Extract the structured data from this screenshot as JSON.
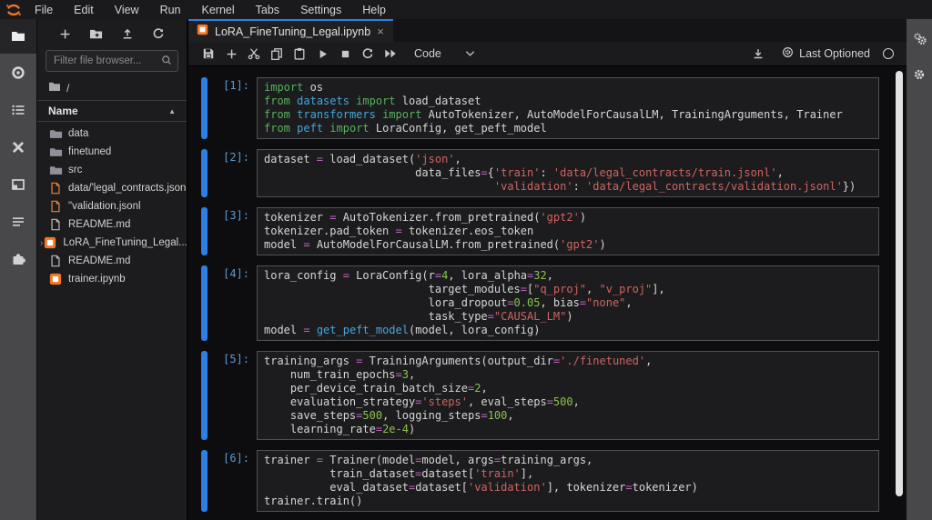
{
  "colors": {
    "accent_blue": "#2e7fe3",
    "jupyter_orange": "#f37726",
    "prompt_blue": "#5b9bd3",
    "syntax_keyword": "#55b25c",
    "syntax_module": "#46a6d9",
    "syntax_string": "#cf6460",
    "syntax_number": "#8bc34a",
    "syntax_operator": "#bd63bd",
    "syntax_default": "#d6d6d6"
  },
  "menu_bar": {
    "items": [
      "File",
      "Edit",
      "View",
      "Run",
      "Kernel",
      "Tabs",
      "Settings",
      "Help"
    ]
  },
  "activity_bar": {
    "icons": [
      "file-browser",
      "running-kernels",
      "command-palette",
      "property-inspector",
      "open-tabs",
      "table-of-contents",
      "extensions"
    ]
  },
  "right_bar": {
    "icons": [
      "notebook-tools",
      "settings-gear"
    ]
  },
  "file_browser": {
    "toolbar": [
      "new-launcher",
      "new-folder",
      "upload",
      "refresh"
    ],
    "filter_placeholder": "Filter file browser...",
    "breadcrumb": "/",
    "column_header": "Name",
    "sort_arrow": "▲",
    "files": [
      {
        "name": "data",
        "icon": "folder"
      },
      {
        "name": "finetuned",
        "icon": "folder"
      },
      {
        "name": "src",
        "icon": "folder"
      },
      {
        "name": "data/'legal_contracts.jsonl",
        "icon": "file-orange"
      },
      {
        "name": "\"validation.jsonl",
        "icon": "file-orange"
      },
      {
        "name": "README.md",
        "icon": "file"
      },
      {
        "name": "LoRA_FineTuning_Legal....",
        "icon": "notebook",
        "caret": "›"
      },
      {
        "name": "README.md",
        "icon": "file"
      },
      {
        "name": "trainer.ipynb",
        "icon": "notebook"
      }
    ]
  },
  "tab": {
    "title": "LoRA_FineTuning_Legal.ipynb",
    "close": "×"
  },
  "notebook_toolbar": {
    "buttons": [
      "save",
      "add-cell",
      "cut-cells",
      "copy-cells",
      "paste-cells",
      "run-cell",
      "stop-kernel",
      "restart-kernel",
      "run-all"
    ],
    "cell_type": "Code",
    "checkpoint_label": "Last Optioned"
  },
  "notebook": {
    "cells": [
      {
        "prompt": "[1]:",
        "source": [
          "import os",
          "from datasets import load_dataset",
          "from transformers import AutoTokenizer, AutoModelForCausalLM, TrainingArguments, Trainer",
          "from peft import LoraConfig, get_peft_model"
        ]
      },
      {
        "prompt": "[2]:",
        "source": [
          "dataset = load_dataset('json',",
          "                       data_files={'train': 'data/legal_contracts/train.jsonl',",
          "                                   'validation': 'data/legal_contracts/validation.jsonl'})"
        ]
      },
      {
        "prompt": "[3]:",
        "source": [
          "tokenizer = AutoTokenizer.from_pretrained('gpt2')",
          "tokenizer.pad_token = tokenizer.eos_token",
          "model = AutoModelForCausalLM.from_pretrained('gpt2')"
        ]
      },
      {
        "prompt": "[4]:",
        "source": [
          "lora_config = LoraConfig(r=4, lora_alpha=32,",
          "                         target_modules=[\"q_proj\", \"v_proj\"],",
          "                         lora_dropout=0.05, bias=\"none\",",
          "                         task_type=\"CAUSAL_LM\")",
          "model = get_peft_model(model, lora_config)"
        ]
      },
      {
        "prompt": "[5]:",
        "source": [
          "training_args = TrainingArguments(output_dir='./finetuned',",
          "    num_train_epochs=3,",
          "    per_device_train_batch_size=2,",
          "    evaluation_strategy='steps', eval_steps=500,",
          "    save_steps=500, logging_steps=100,",
          "    learning_rate=2e-4)"
        ]
      },
      {
        "prompt": "[6]:",
        "source": [
          "trainer = Trainer(model=model, args=training_args,",
          "          train_dataset=dataset['train'],",
          "          eval_dataset=dataset['validation'], tokenizer=tokenizer)",
          "trainer.train()"
        ]
      }
    ]
  }
}
